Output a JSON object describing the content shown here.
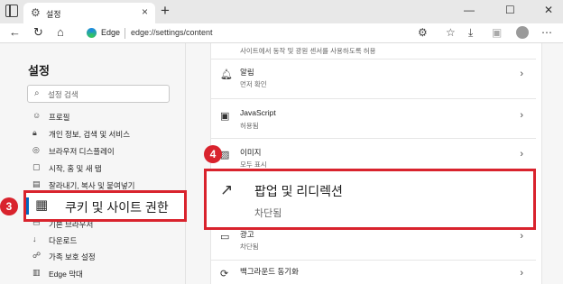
{
  "browser": {
    "tab_title": "설정",
    "new_tab_glyph": "+",
    "window_controls": [
      "—",
      "☐",
      "✕"
    ],
    "address_brand": "Edge",
    "address_url": "edge://settings/content"
  },
  "sidebar": {
    "title": "설정",
    "search_placeholder": "설정 검색",
    "items": [
      {
        "label": "프로필",
        "icon": "profile-icon"
      },
      {
        "label": "개인 정보, 검색 및 서비스",
        "icon": "lock-icon"
      },
      {
        "label": "브라우저 디스플레이",
        "icon": "palette-icon"
      },
      {
        "label": "시작, 홈 및 새 탭",
        "icon": "home-icon"
      },
      {
        "label": "잘라내기, 복사 및 붙여넣기",
        "icon": "clipboard-icon"
      },
      {
        "label": "쿠키 및 사이트 권한",
        "icon": "site-permissions-icon"
      },
      {
        "label": "기본 브라우저",
        "icon": "browser-icon"
      },
      {
        "label": "다운로드",
        "icon": "download-icon"
      },
      {
        "label": "가족 보호 설정",
        "icon": "family-icon"
      },
      {
        "label": "Edge 막대",
        "icon": "edge-bar-icon"
      }
    ]
  },
  "main": {
    "top_description": "사이트에서 동작 및 광원 센서를 사용하도록 허용",
    "rows": [
      {
        "title": "알림",
        "subtitle": "먼저 확인",
        "icon": "bell-icon"
      },
      {
        "title": "JavaScript",
        "subtitle": "허용됨",
        "icon": "code-icon"
      },
      {
        "title": "이미지",
        "subtitle": "모두 표시",
        "icon": "image-icon"
      },
      {
        "title": "광고",
        "subtitle": "차단됨",
        "icon": "ads-icon"
      },
      {
        "title": "백그라운드 동기화",
        "subtitle": "",
        "icon": "sync-icon"
      }
    ]
  },
  "highlights": {
    "cookie": {
      "label": "쿠키 및 사이트 권한",
      "marker": "3"
    },
    "popup": {
      "title": "팝업 및 리디렉션",
      "subtitle": "차단됨",
      "marker": "4"
    }
  },
  "colors": {
    "highlight_border": "#d9232d",
    "accent": "#0067c0"
  }
}
